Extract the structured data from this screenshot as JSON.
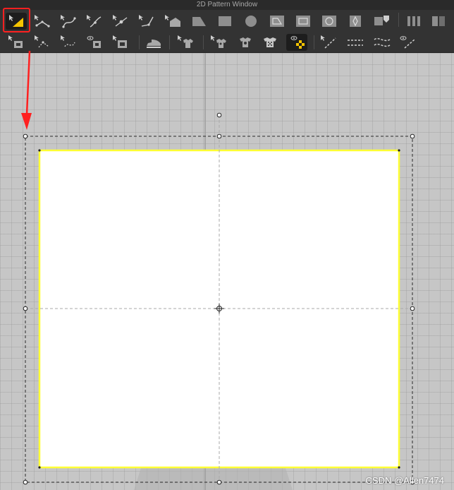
{
  "window": {
    "title": "2D Pattern Window"
  },
  "colors": {
    "selection_yellow": "#ffff33",
    "annotation_red": "#ff2020",
    "pattern_fill": "#ffffff",
    "grid_bg": "#c6c6c6"
  },
  "toolbar_row1": [
    {
      "name": "transform-pattern-tool-icon",
      "active": true
    },
    {
      "name": "edit-point-line-tool-icon"
    },
    {
      "name": "edit-curvature-tool-icon"
    },
    {
      "name": "edit-curve-point-tool-icon"
    },
    {
      "name": "add-point-tool-icon"
    },
    {
      "name": "cut-curve-tool-icon"
    },
    {
      "name": "polygon-pattern-tool-icon"
    },
    {
      "name": "trapezoid-shape-icon"
    },
    {
      "name": "rectangle-shape-icon"
    },
    {
      "name": "circle-shape-icon"
    },
    {
      "name": "internal-polygon-icon"
    },
    {
      "name": "internal-rectangle-icon"
    },
    {
      "name": "internal-circle-icon"
    },
    {
      "name": "dart-tool-icon"
    },
    {
      "name": "trace-tool-icon"
    },
    {
      "name": "pleat-tool-icon"
    }
  ],
  "toolbar_row2": [
    {
      "name": "offset-tool-icon"
    },
    {
      "name": "edit-offset-tool-icon"
    },
    {
      "name": "curved-offset-tool-icon"
    },
    {
      "name": "show-pattern-tool-icon"
    },
    {
      "name": "pattern-layout-tool-icon"
    },
    {
      "name": "steam-iron-icon"
    },
    {
      "name": "shirt-select-icon"
    },
    {
      "name": "garment-edit-icon"
    },
    {
      "name": "garment-pin-icon"
    },
    {
      "name": "garment-fabric-icon"
    },
    {
      "name": "show-3d-arrangement-icon",
      "active": true
    },
    {
      "name": "segment-sewing-tool-icon"
    },
    {
      "name": "free-sewing-tool-icon"
    },
    {
      "name": "edit-sewing-tool-icon"
    },
    {
      "name": "tack-tool-icon"
    }
  ],
  "watermark": "CSDN @Allen7474"
}
